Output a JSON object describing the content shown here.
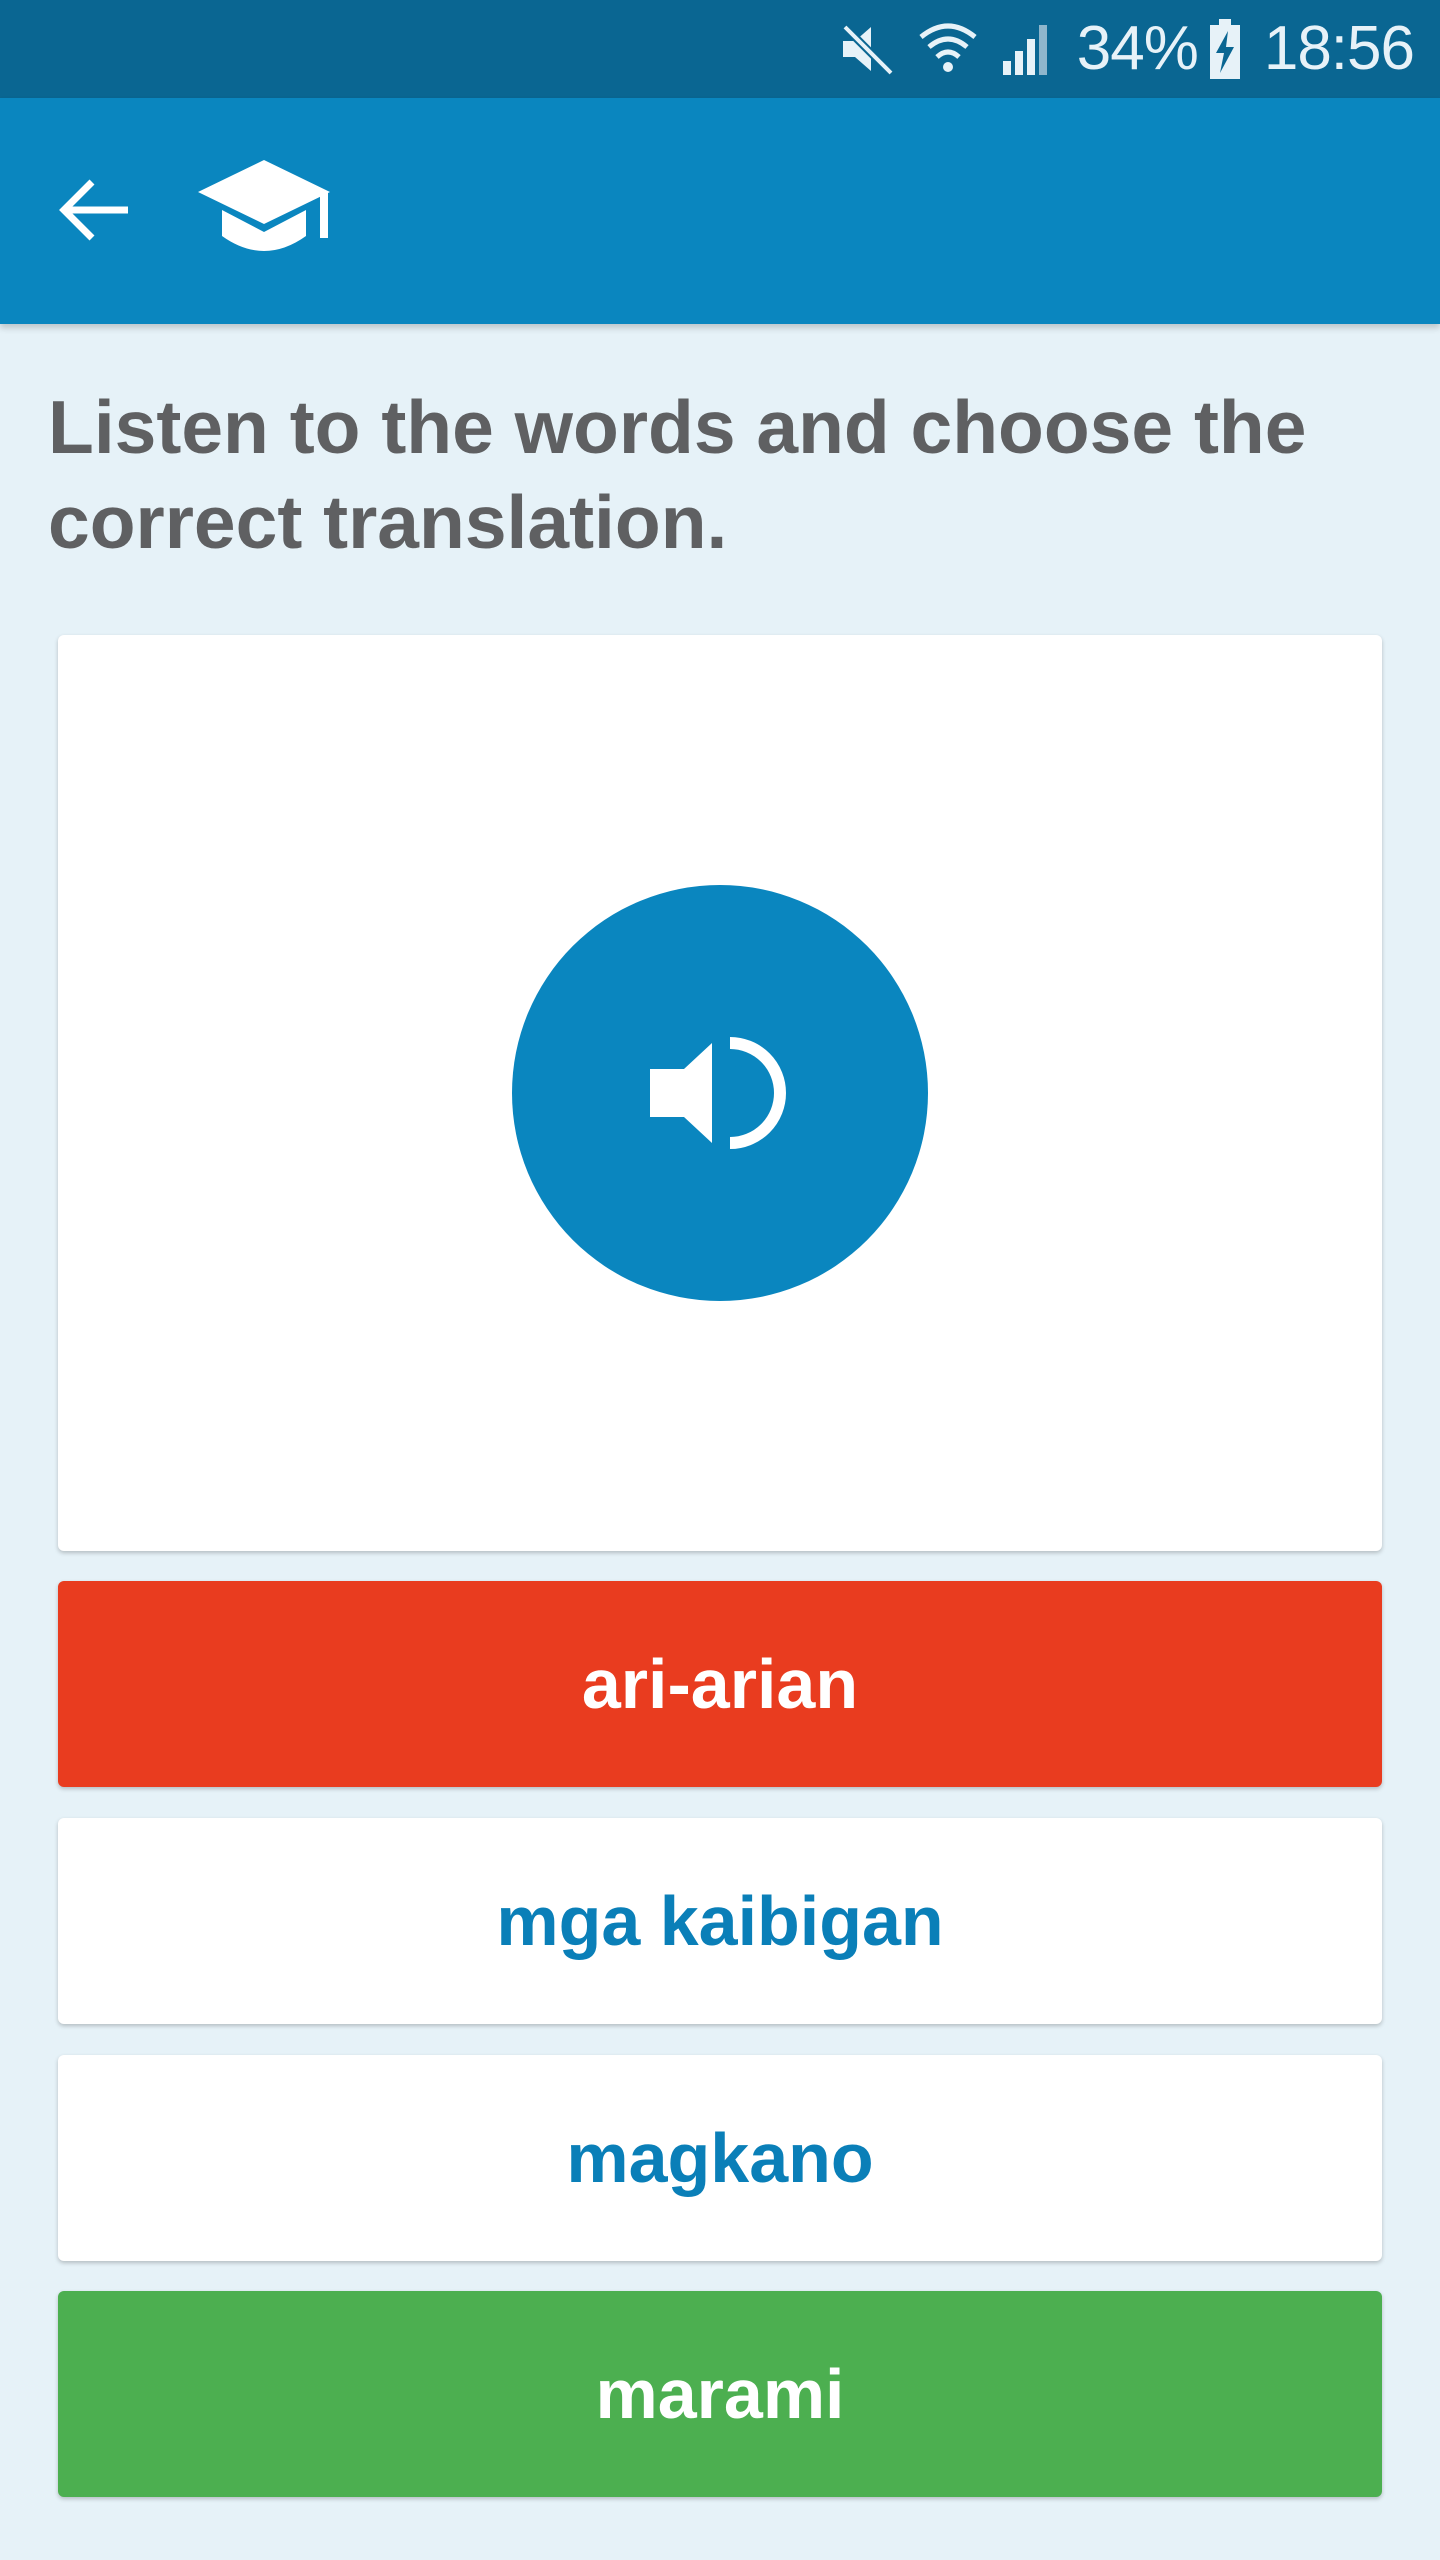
{
  "status_bar": {
    "battery": "34%",
    "time": "18:56",
    "icons": [
      "mute-icon",
      "wifi-icon",
      "signal-icon",
      "battery-charging-icon"
    ]
  },
  "app_bar": {
    "icons": [
      "back-arrow-icon",
      "graduation-cap-icon"
    ],
    "color": "#0a86bf"
  },
  "instruction": "Listen to the words and choose the correct translation.",
  "audio_card": {
    "icon": "speaker-icon"
  },
  "options": [
    {
      "label": "ari-arian",
      "state": "incorrect",
      "color": "#e93c1f"
    },
    {
      "label": "mga kaibigan",
      "state": "default",
      "color": "#ffffff"
    },
    {
      "label": "magkano",
      "state": "default",
      "color": "#ffffff"
    },
    {
      "label": "marami",
      "state": "correct",
      "color": "#4caf50"
    }
  ]
}
